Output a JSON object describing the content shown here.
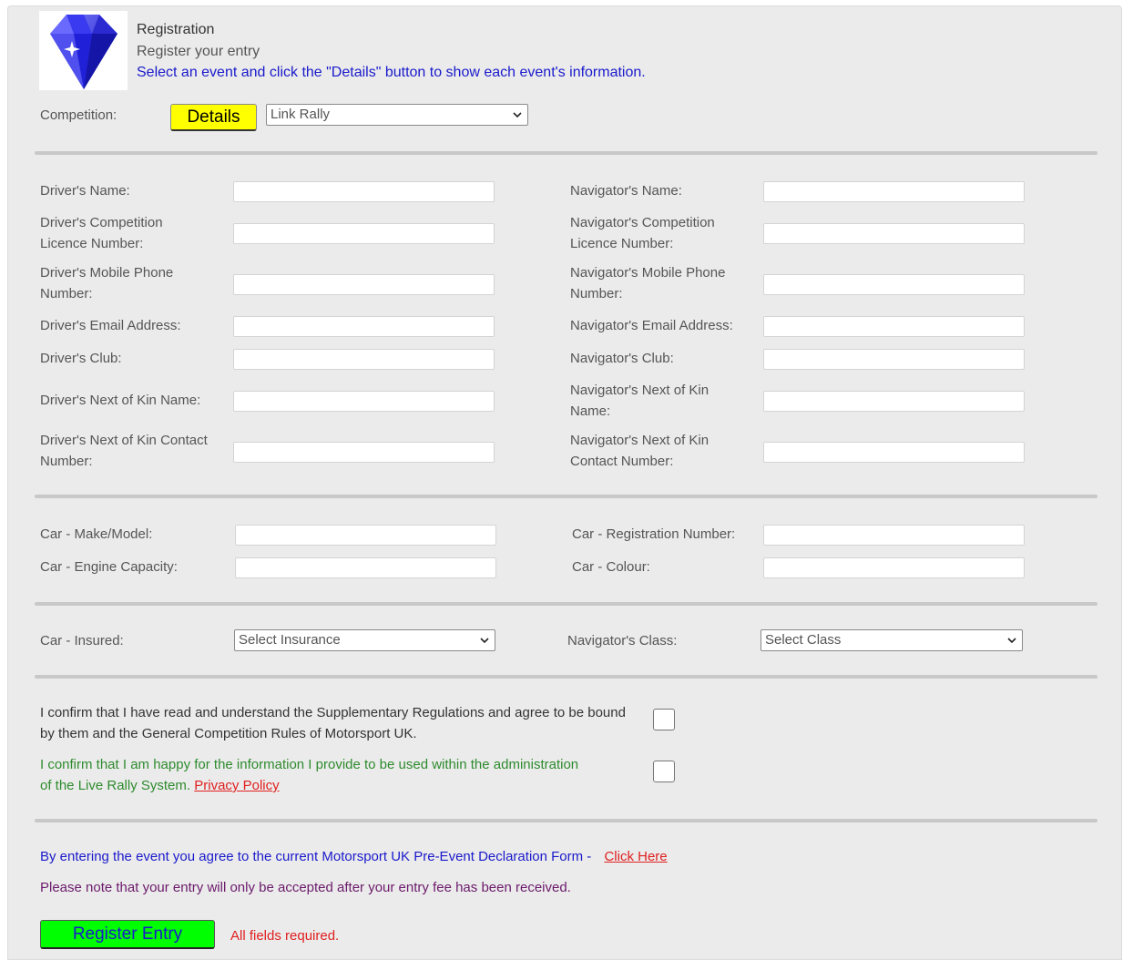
{
  "header": {
    "title": "Registration",
    "subtitle": "Register your entry",
    "instruction": "Select an event and click the \"Details\" button to show each event's information."
  },
  "competition": {
    "label": "Competition:",
    "details_button": "Details",
    "selected": "Link Rally"
  },
  "people": {
    "driver": [
      {
        "label": "Driver's Name:",
        "value": ""
      },
      {
        "label": "Driver's Competition Licence Number:",
        "value": ""
      },
      {
        "label": "Driver's Mobile Phone Number:",
        "value": ""
      },
      {
        "label": "Driver's Email Address:",
        "value": ""
      },
      {
        "label": "Driver's Club:",
        "value": ""
      },
      {
        "label": "Driver's Next of Kin Name:",
        "value": ""
      },
      {
        "label": "Driver's Next of Kin Contact Number:",
        "value": ""
      }
    ],
    "navigator": [
      {
        "label": "Navigator's Name:",
        "value": ""
      },
      {
        "label": "Navigator's Competition Licence Number:",
        "value": ""
      },
      {
        "label": "Navigator's Mobile Phone Number:",
        "value": ""
      },
      {
        "label": "Navigator's Email Address:",
        "value": ""
      },
      {
        "label": "Navigator's Club:",
        "value": ""
      },
      {
        "label": "Navigator's Next of Kin Name:",
        "value": ""
      },
      {
        "label": "Navigator's Next of Kin Contact Number:",
        "value": ""
      }
    ]
  },
  "car": {
    "make_label": "Car - Make/Model:",
    "reg_label": "Car - Registration Number:",
    "engine_label": "Car - Engine Capacity:",
    "colour_label": "Car - Colour:"
  },
  "selects": {
    "insured_label": "Car - Insured:",
    "insured_value": "Select Insurance",
    "class_label": "Navigator's Class:",
    "class_value": "Select Class"
  },
  "confirm": {
    "regs_text": "I confirm that I have read and understand the Supplementary Regulations and agree to be bound by them and the General Competition Rules of Motorsport UK.",
    "privacy_text": "I confirm that I am happy for the information I provide to be used within the administration of the Live Rally System.",
    "privacy_link": "Privacy Policy"
  },
  "footer": {
    "declaration_text": "By entering the event you agree to the current Motorsport UK Pre-Event Declaration Form -",
    "declaration_link": "Click Here",
    "fee_note": "Please note that your entry will only be accepted after your entry fee has been received.",
    "register_button": "Register Entry",
    "required_note": "All fields required."
  },
  "colors": {
    "details_button_bg": "#ffff00",
    "register_button_bg": "#00ff00",
    "link_blue": "#1a1acc",
    "privacy_green": "#2e8b2e",
    "note_purple": "#6b1a6b",
    "error_red": "#e02020"
  },
  "icons": {
    "logo": "diamond-logo-icon"
  }
}
